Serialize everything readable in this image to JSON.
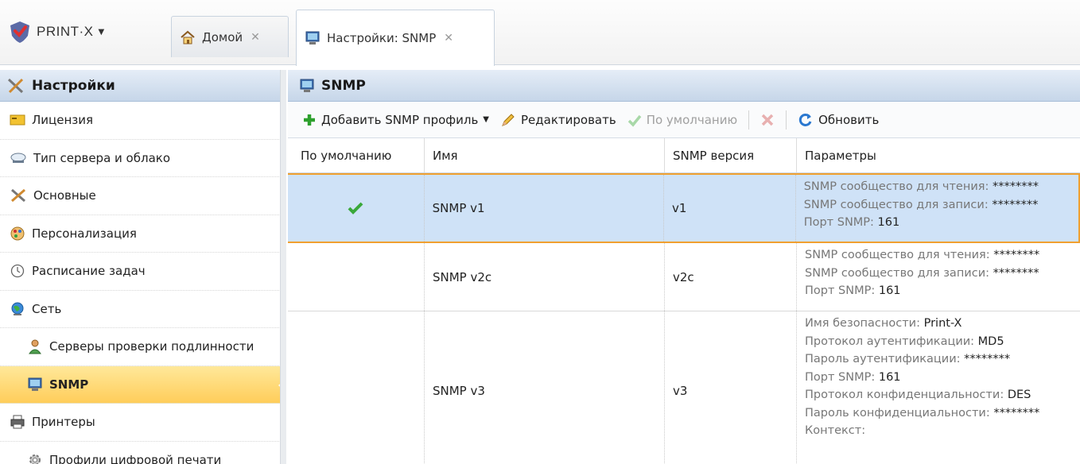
{
  "app": {
    "brand": "PRINT·X"
  },
  "tabs": [
    {
      "label": "Домой"
    },
    {
      "label": "Настройки: SNMP"
    }
  ],
  "sidebar": {
    "title": "Настройки",
    "items": [
      {
        "label": "Лицензия",
        "icon": "license-icon"
      },
      {
        "label": "Тип сервера и облако",
        "icon": "cloud-icon"
      },
      {
        "label": "Основные",
        "icon": "tools-icon"
      },
      {
        "label": "Персонализация",
        "icon": "palette-icon"
      },
      {
        "label": "Расписание задач",
        "icon": "clock-icon"
      },
      {
        "label": "Сеть",
        "icon": "globe-icon"
      },
      {
        "label": "Серверы проверки подлинности",
        "icon": "user-icon"
      },
      {
        "label": "SNMP",
        "icon": "monitor-icon"
      },
      {
        "label": "Принтеры",
        "icon": "printer-icon"
      },
      {
        "label": "Профили цифровой печати",
        "icon": "gear-icon"
      }
    ]
  },
  "main": {
    "title": "SNMP",
    "toolbar": {
      "add": "Добавить SNMP профиль",
      "edit": "Редактировать",
      "default": "По умолчанию",
      "refresh": "Обновить"
    },
    "columns": [
      "По умолчанию",
      "Имя",
      "SNMP версия",
      "Параметры"
    ],
    "rows": [
      {
        "name": "SNMP v1",
        "version": "v1",
        "is_default": true,
        "params": [
          {
            "k": "SNMP сообщество для чтения:",
            "v": "********"
          },
          {
            "k": "SNMP сообщество для записи:",
            "v": "********"
          },
          {
            "k": "Порт SNMP:",
            "v": "161"
          }
        ]
      },
      {
        "name": "SNMP v2c",
        "version": "v2c",
        "is_default": false,
        "params": [
          {
            "k": "SNMP сообщество для чтения:",
            "v": "********"
          },
          {
            "k": "SNMP сообщество для записи:",
            "v": "********"
          },
          {
            "k": "Порт SNMP:",
            "v": "161"
          }
        ]
      },
      {
        "name": "SNMP v3",
        "version": "v3",
        "is_default": false,
        "params": [
          {
            "k": "Имя безопасности:",
            "v": "Print-X"
          },
          {
            "k": "Протокол аутентификации:",
            "v": "MD5"
          },
          {
            "k": "Пароль аутентификации:",
            "v": "********"
          },
          {
            "k": "Порт SNMP:",
            "v": "161"
          },
          {
            "k": "Протокол конфиденциальности:",
            "v": "DES"
          },
          {
            "k": "Пароль конфиденциальности:",
            "v": "********"
          },
          {
            "k": "Контекст:",
            "v": ""
          }
        ]
      }
    ]
  },
  "colors": {
    "accent": "#f0a030",
    "selected_row": "#cfe2f7",
    "active_nav": "#ffcd5a",
    "header": "#c6d6e9"
  }
}
